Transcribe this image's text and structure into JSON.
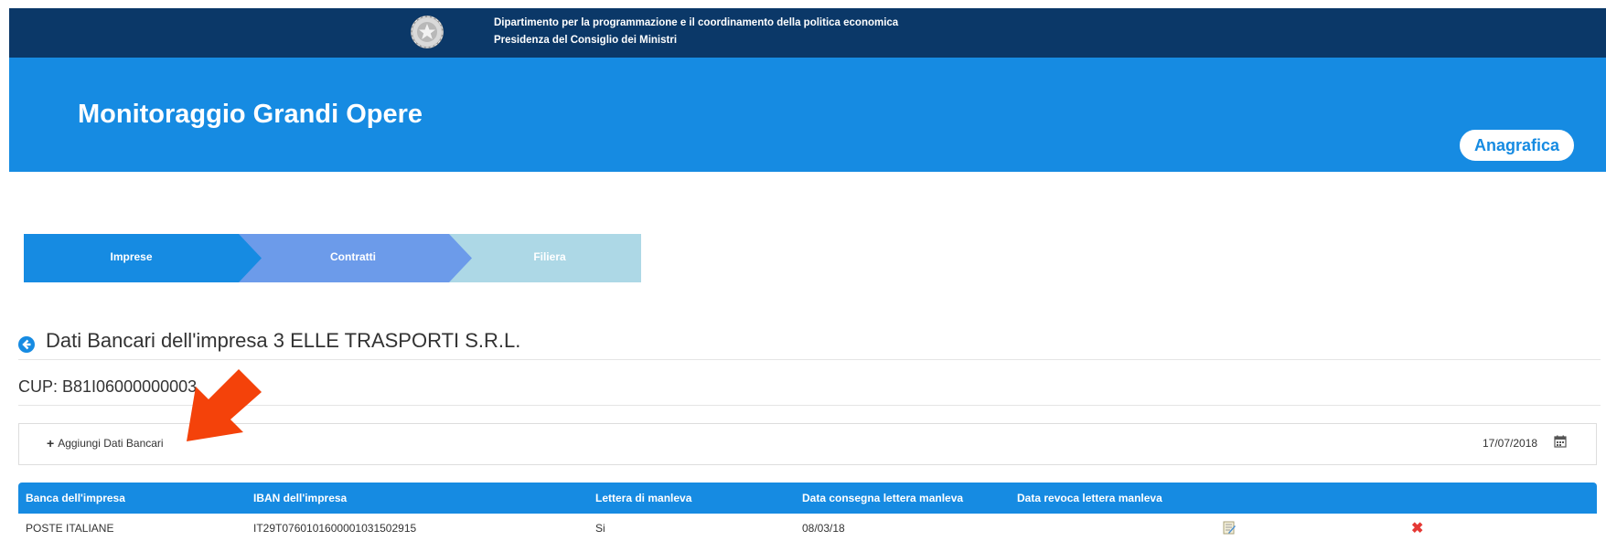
{
  "header": {
    "department_line1": "Dipartimento per la programmazione e il coordinamento della politica economica",
    "department_line2": "Presidenza del Consiglio dei Ministri",
    "emblem_icon": "italian-republic-emblem-icon"
  },
  "hero": {
    "title": "Monitoraggio Grandi Opere",
    "anagrafica_label": "Anagrafica"
  },
  "steps": [
    {
      "label": "Imprese",
      "color": "#168be2"
    },
    {
      "label": "Contratti",
      "color": "#6c9bea"
    },
    {
      "label": "Filiera",
      "color": "#add8e6"
    }
  ],
  "page": {
    "heading": "Dati Bancari dell'impresa 3 ELLE TRASPORTI S.R.L.",
    "cup": "CUP: B81I06000000003"
  },
  "toolbar": {
    "add_label": "Aggiungi Dati Bancari",
    "date": "17/07/2018"
  },
  "table": {
    "headers": [
      "Banca dell'impresa",
      "IBAN dell'impresa",
      "Lettera di manleva",
      "Data consegna lettera manleva",
      "Data revoca lettera manleva"
    ],
    "rows": [
      {
        "bank": "POSTE ITALIANE",
        "iban": "IT29T0760101600001031502915",
        "manleva": "Si",
        "consegna": "08/03/18",
        "revoca": ""
      }
    ]
  },
  "colors": {
    "topbar": "#0b3868",
    "accent": "#168be2",
    "annotation_arrow": "#f4420a",
    "delete": "#e53935"
  }
}
